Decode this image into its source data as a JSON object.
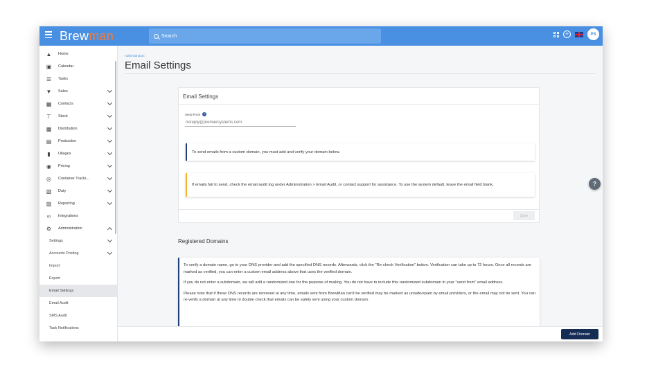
{
  "app": {
    "logo_main": "Brew",
    "logo_accent": "man",
    "search_placeholder": "Search",
    "avatar_initials": "PS",
    "accent_color": "#4a90e2",
    "logo_accent_color": "#f47a3a"
  },
  "sidebar": {
    "items": [
      {
        "label": "Home",
        "icon": "home-icon"
      },
      {
        "label": "Calendar",
        "icon": "calendar-icon"
      },
      {
        "label": "Tasks",
        "icon": "list-icon"
      },
      {
        "label": "Sales",
        "icon": "basket-icon"
      },
      {
        "label": "Contacts",
        "icon": "contacts-icon"
      },
      {
        "label": "Stock",
        "icon": "stock-icon"
      },
      {
        "label": "Distribution",
        "icon": "truck-icon"
      },
      {
        "label": "Production",
        "icon": "production-icon"
      },
      {
        "label": "Ullages",
        "icon": "ullages-icon"
      },
      {
        "label": "Pricing",
        "icon": "pricing-icon"
      },
      {
        "label": "Container Tracki...",
        "icon": "target-icon"
      },
      {
        "label": "Duty",
        "icon": "duty-icon"
      },
      {
        "label": "Reporting",
        "icon": "reporting-icon"
      },
      {
        "label": "Integrations",
        "icon": "link-icon"
      },
      {
        "label": "Administration",
        "icon": "gear-icon"
      }
    ],
    "sub_items": [
      {
        "label": "Settings"
      },
      {
        "label": "Accounts Posting"
      },
      {
        "label": "Import"
      },
      {
        "label": "Export"
      },
      {
        "label": "Email Settings"
      },
      {
        "label": "Email Audit"
      },
      {
        "label": "SMS Audit"
      },
      {
        "label": "Task Notifications"
      }
    ]
  },
  "page": {
    "breadcrumb": "Administration",
    "title": "Email Settings"
  },
  "email_card": {
    "title": "Email Settings",
    "send_from_label": "Send From",
    "send_from_value": "noreply@premiersystems.com",
    "info_note": "To send emails from a custom domain, you must add and verify your domain below.",
    "warning_note": "If emails fail to send, check the email audit log under Administration > Email Audit, or contact support for assistance. To use the system default, leave the email field blank.",
    "save_label": "Save"
  },
  "registered_domains": {
    "title": "Registered Domains",
    "para1": "To verify a domain name, go to your DNS provider and add the specified DNS records. Afterwards, click the \"Re-check Verification\" button. Verification can take up to 72 hours. Once all records are marked as verified, you can enter a custom email address above that uses the verified domain.",
    "para2": "If you do not enter a subdomain, we will add a randomized one for the purpose of mailing. You do not have to include this randomized subdomain in your \"send from\" email address.",
    "para3": "Please note that if these DNS records are removed at any time, emails sent from BrewMan can't be verified may be marked as unsafe/spam by email providers, or the email may not be sent. You can re-verify a domain at any time to double check that emails can be safely sent using your custom domain."
  },
  "footer": {
    "add_domain_label": "Add Domain"
  }
}
